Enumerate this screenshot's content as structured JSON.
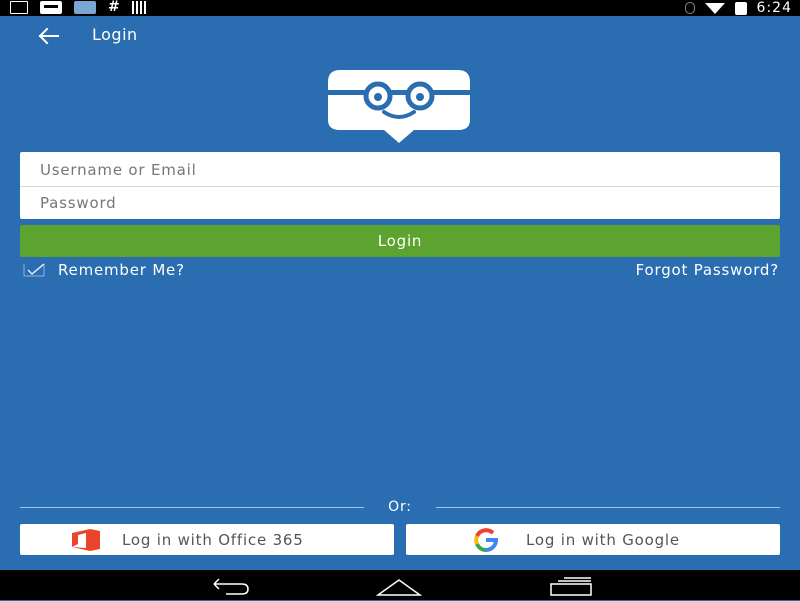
{
  "status_bar": {
    "time": "6:24",
    "left_icons": [
      "download-icon",
      "message-icon",
      "app-icon",
      "hash-icon",
      "barcode-icon"
    ],
    "right_icons": [
      "bluetooth-icon",
      "wifi-icon",
      "battery-charging-icon"
    ]
  },
  "header": {
    "title": "Login",
    "back_icon": "arrow-left-icon"
  },
  "form": {
    "username_placeholder": "Username or Email",
    "password_placeholder": "Password",
    "login_label": "Login",
    "remember_label": "Remember Me?",
    "remember_checked": true,
    "forgot_label": "Forgot Password?"
  },
  "divider": {
    "label": "Or:"
  },
  "social": {
    "office_label": "Log in with Office 365",
    "google_label": "Log in with Google"
  },
  "navigation": {
    "buttons": [
      "back-icon",
      "home-icon",
      "recent-apps-icon"
    ]
  },
  "colors": {
    "background": "#2a6db0",
    "login_button": "#5da330",
    "office_red": "#e8452c",
    "google_blue": "#4285f4",
    "google_red": "#ea4335",
    "google_yellow": "#fbbc05",
    "google_green": "#34a853"
  }
}
